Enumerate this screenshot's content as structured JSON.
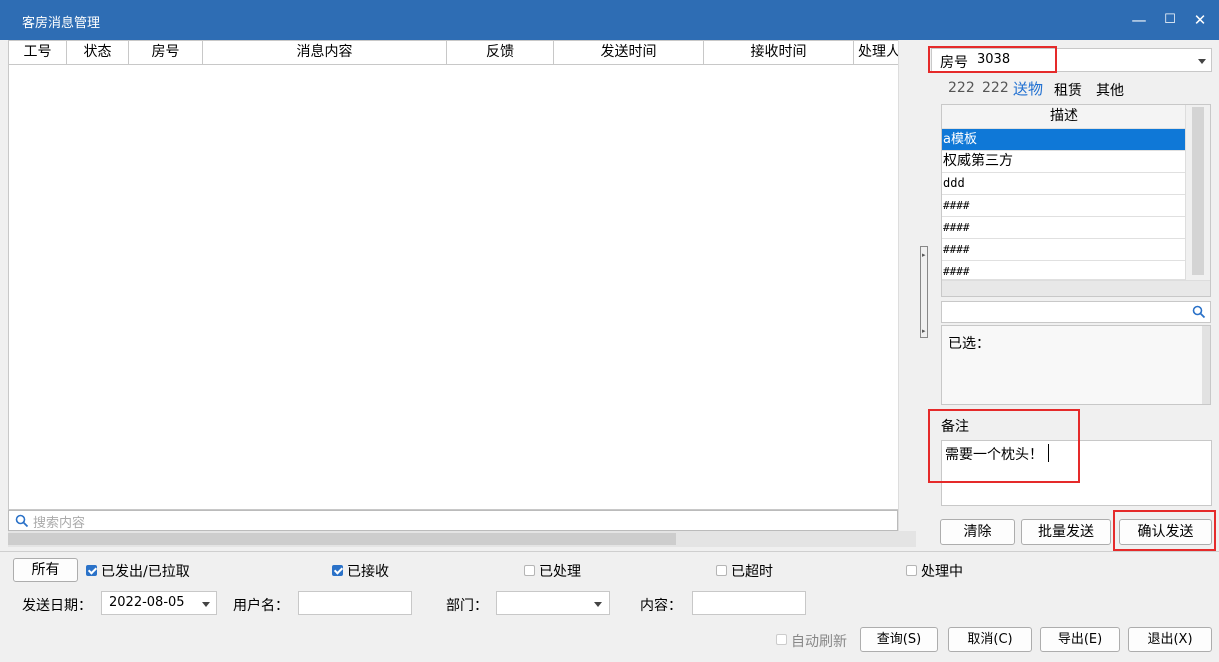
{
  "window": {
    "title": "客房消息管理",
    "min": "—",
    "max": "☐",
    "close": "✕"
  },
  "grid": {
    "columns": [
      "工号",
      "状态",
      "房号",
      "消息内容",
      "反馈",
      "发送时间",
      "接收时间",
      "处理人"
    ],
    "rows": []
  },
  "search": {
    "placeholder": "搜索内容"
  },
  "right": {
    "room_label": "房号",
    "room_value": "3038",
    "tabs": [
      "222",
      "222",
      "送物",
      "租赁",
      "其他"
    ],
    "active_tab": "送物",
    "desc_header": "描述",
    "desc_items": [
      "a模板",
      "权威第三方",
      "ddd",
      "####",
      "####",
      "####",
      "####"
    ],
    "selected_item": "a模板",
    "selected_label": "已选：",
    "remark_label": "备注",
    "remark_value": "需要一个枕头！",
    "btn_clear": "清除",
    "btn_batch_send": "批量发送",
    "btn_confirm_send": "确认发送"
  },
  "filters": {
    "btn_all": "所有",
    "cb_sent": {
      "label": "已发出/已拉取",
      "checked": true
    },
    "cb_received": {
      "label": "已接收",
      "checked": true
    },
    "cb_processed": {
      "label": "已处理",
      "checked": false
    },
    "cb_timeout": {
      "label": "已超时",
      "checked": false
    },
    "cb_processing": {
      "label": "处理中",
      "checked": false
    },
    "send_date_label": "发送日期：",
    "send_date_value": "2022-08-05",
    "username_label": "用户名：",
    "username_value": "",
    "dept_label": "部门：",
    "dept_value": "",
    "content_label": "内容：",
    "content_value": ""
  },
  "footer": {
    "auto_refresh": {
      "label": "自动刷新",
      "checked": false
    },
    "btn_query": "查询(S)",
    "btn_cancel": "取消(C)",
    "btn_export": "导出(E)",
    "btn_exit": "退出(X)"
  },
  "colors": {
    "title_bar": "#2e6db4",
    "highlight": "#e52a2a",
    "selected_row": "#0f78d7",
    "active_tab": "#1f6fd1"
  }
}
